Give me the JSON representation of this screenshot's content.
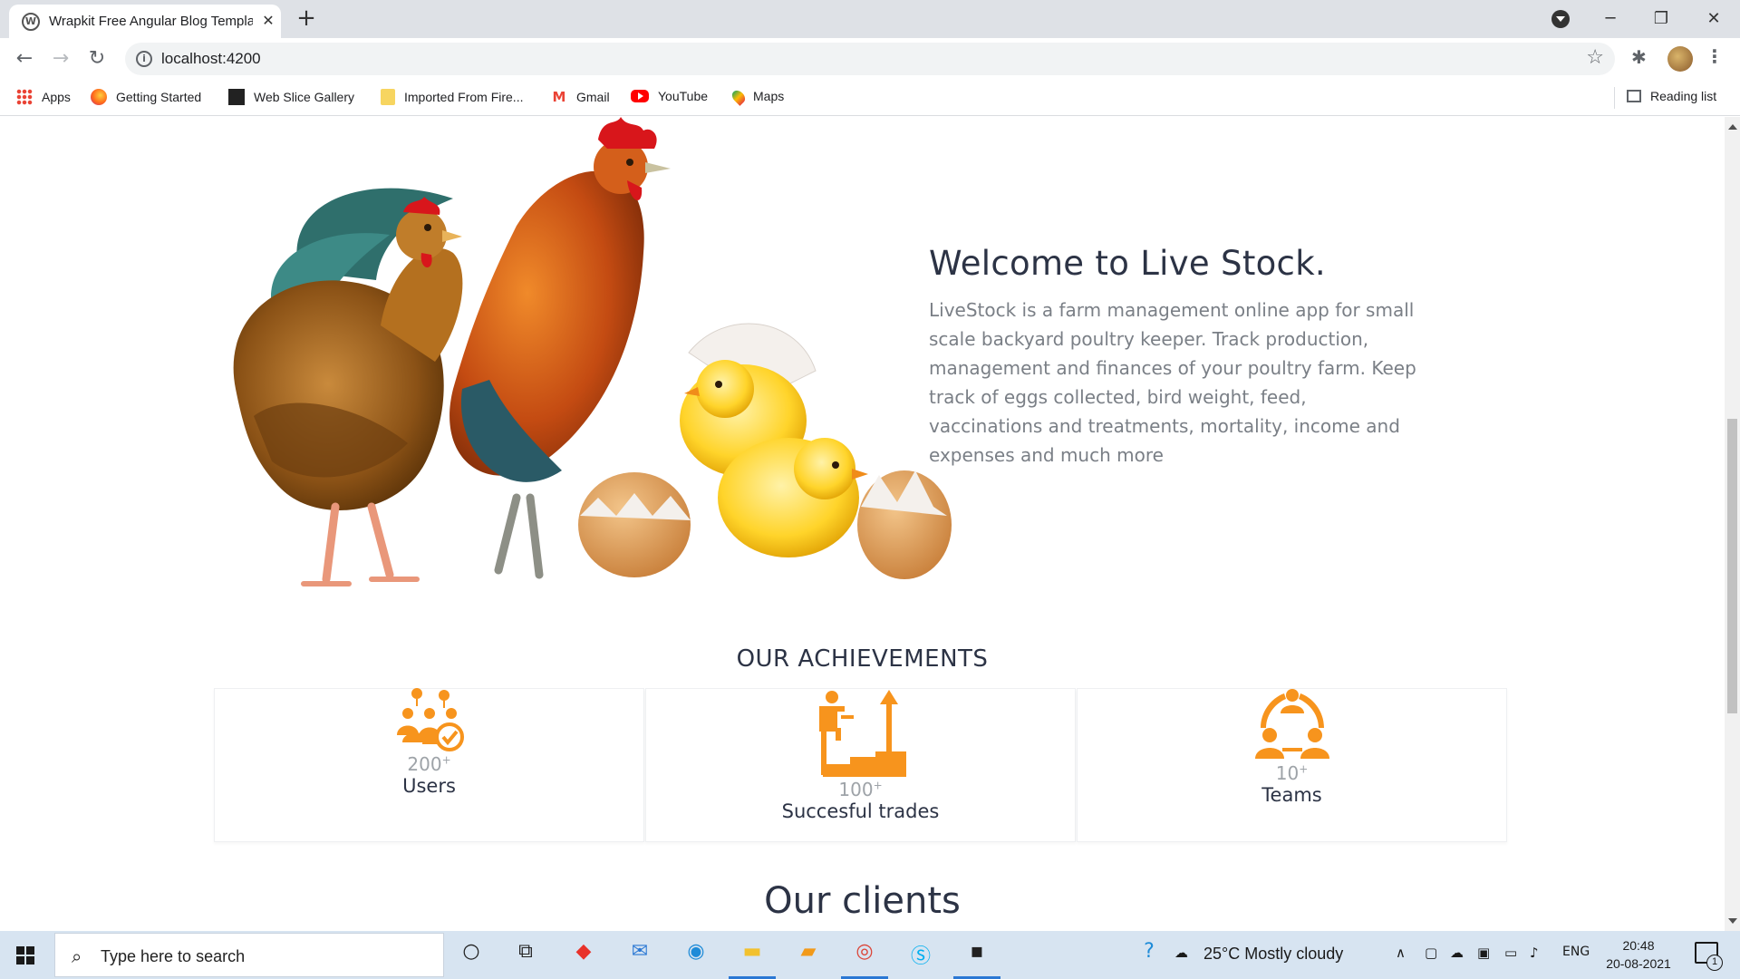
{
  "browser": {
    "tab_title": "Wrapkit Free Angular Blog Template",
    "tab_favicon_letter": "W",
    "url": "localhost:4200",
    "bookmarks": [
      "Apps",
      "Getting Started",
      "Web Slice Gallery",
      "Imported From Fire...",
      "Gmail",
      "YouTube",
      "Maps"
    ],
    "reading_list": "Reading list"
  },
  "hero": {
    "title": "Welcome to Live Stock.",
    "body": "LiveStock is a farm management online app for small scale backyard poultry keeper. Track production, management and finances of your poultry farm. Keep track of eggs collected, bird weight, feed, vaccinations and treatments, mortality, income and expenses and much more"
  },
  "achievements": {
    "title": "OUR ACHIEVEMENTS",
    "items": [
      {
        "number": "200",
        "suffix": "+",
        "label": "Users",
        "icon": "users-check-icon"
      },
      {
        "number": "100",
        "suffix": "+",
        "label": "Succesful trades",
        "icon": "steps-growth-icon"
      },
      {
        "number": "10",
        "suffix": "+",
        "label": "Teams",
        "icon": "team-meeting-icon"
      }
    ]
  },
  "clients": {
    "title": "Our clients"
  },
  "taskbar": {
    "search_placeholder": "Type here to search",
    "weather": "25°C  Mostly cloudy",
    "language": "ENG",
    "time": "20:48",
    "date": "20-08-2021",
    "notification_count": "1"
  },
  "colors": {
    "accent": "#f7941d",
    "heading": "#2c3345",
    "body_text": "#7a7f86"
  }
}
